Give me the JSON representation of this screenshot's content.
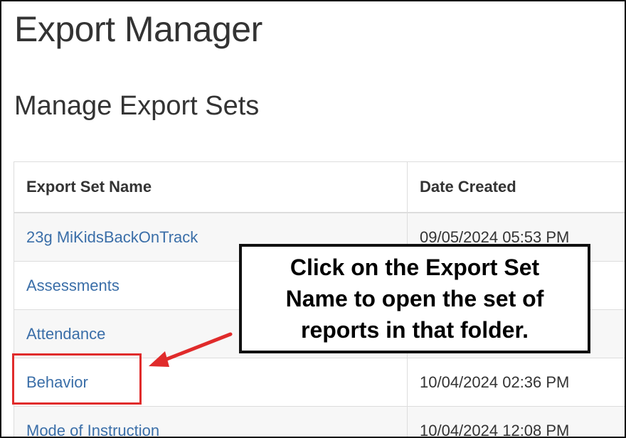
{
  "page_title": "Export Manager",
  "section_title": "Manage Export Sets",
  "table": {
    "headers": [
      "Export Set Name",
      "Date Created"
    ],
    "rows": [
      {
        "name": "23g MiKidsBackOnTrack",
        "date": "09/05/2024 05:53 PM"
      },
      {
        "name": "Assessments",
        "date": ""
      },
      {
        "name": "Attendance",
        "date": ""
      },
      {
        "name": "Behavior",
        "date": "10/04/2024 02:36 PM"
      },
      {
        "name": "Mode of Instruction",
        "date": "10/04/2024 12:08 PM"
      }
    ]
  },
  "callout": {
    "text": "Click on the Export Set Name to open the set of reports in that folder."
  },
  "colors": {
    "link": "#3a6ea8",
    "highlight": "#e02b2b",
    "text": "#333333"
  }
}
